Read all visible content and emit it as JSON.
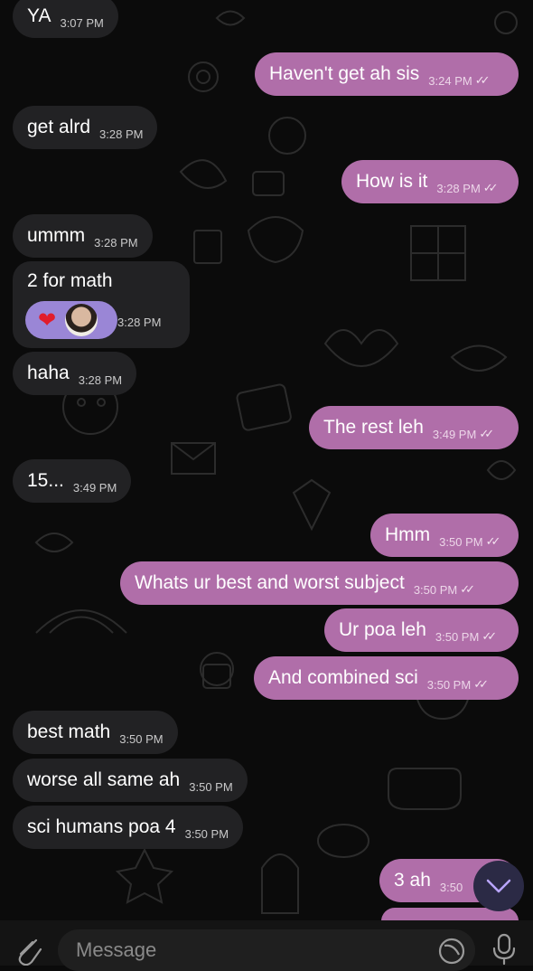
{
  "chat": {
    "messages": [
      {
        "side": "in",
        "text": "YA",
        "time": "3:07 PM"
      },
      {
        "side": "out",
        "text": "Haven't get ah sis",
        "time": "3:24 PM",
        "ticks": "✓✓"
      },
      {
        "side": "in",
        "text": "get alrd",
        "time": "3:28 PM"
      },
      {
        "side": "out",
        "text": "How is it",
        "time": "3:28 PM",
        "ticks": "✓✓"
      },
      {
        "side": "in",
        "text": "ummm",
        "time": "3:28 PM"
      },
      {
        "side": "in",
        "text": "2 for math",
        "time": "3:28 PM",
        "reaction": "❤"
      },
      {
        "side": "in",
        "text": "haha",
        "time": "3:28 PM"
      },
      {
        "side": "out",
        "text": "The rest leh",
        "time": "3:49 PM",
        "ticks": "✓✓"
      },
      {
        "side": "in",
        "text": "15...",
        "time": "3:49 PM"
      },
      {
        "side": "out",
        "text": "Hmm",
        "time": "3:50 PM",
        "ticks": "✓✓"
      },
      {
        "side": "out",
        "text": "Whats ur best and worst subject",
        "time": "3:50 PM",
        "ticks": "✓✓"
      },
      {
        "side": "out",
        "text": "Ur poa leh",
        "time": "3:50 PM",
        "ticks": "✓✓"
      },
      {
        "side": "out",
        "text": "And combined sci",
        "time": "3:50 PM",
        "ticks": "✓✓"
      },
      {
        "side": "in",
        "text": "best math",
        "time": "3:50 PM"
      },
      {
        "side": "in",
        "text": "worse all same ah",
        "time": "3:50 PM"
      },
      {
        "side": "in",
        "text": "sci humans poa 4",
        "time": "3:50 PM"
      },
      {
        "side": "out",
        "text": "3 ah",
        "time": "3:50"
      }
    ]
  },
  "composer": {
    "placeholder": "Message",
    "attach_icon": "paperclip-icon",
    "sticker_icon": "sticker-icon",
    "mic_icon": "microphone-icon"
  },
  "scroll_down_icon": "chevron-down-icon",
  "colors": {
    "background": "#0b0b0b",
    "incoming_bubble": "#222224",
    "outgoing_bubble": "#b06ea9",
    "reaction_pill": "#9a86d6",
    "scroll_button": "#2b2a45"
  }
}
